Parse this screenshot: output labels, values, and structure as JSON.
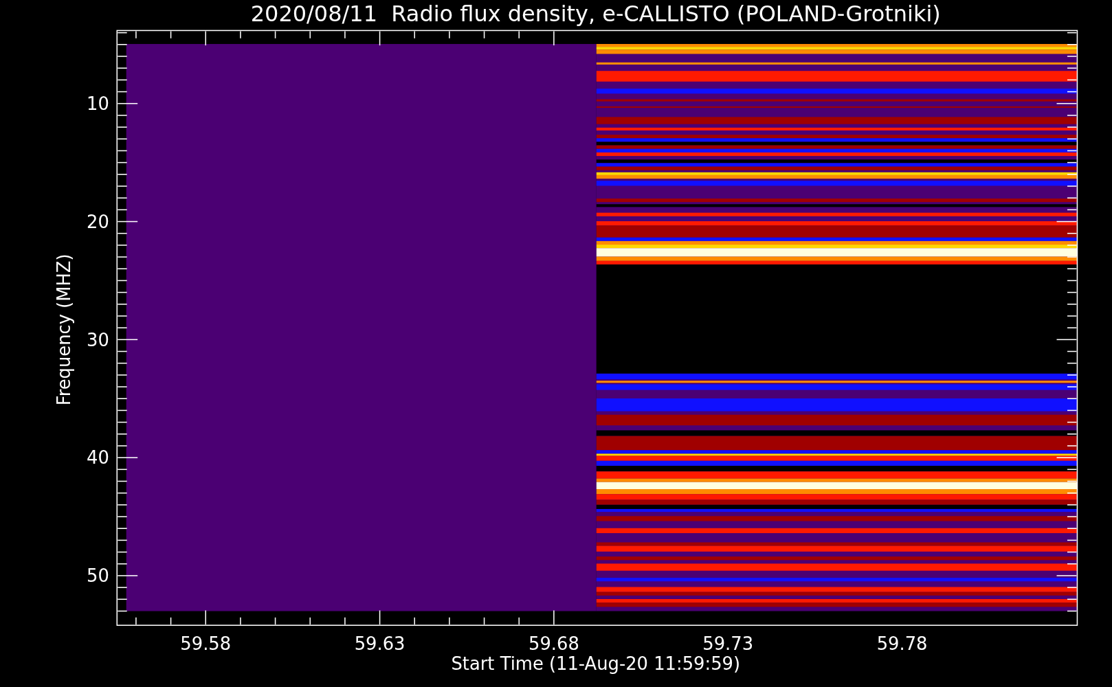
{
  "plot": {
    "title": "2020/08/11  Radio flux density, e-CALLISTO (POLAND-Grotniki)",
    "y_axis": {
      "label": "Frequency (MHZ)",
      "ticks": [
        "10",
        "20",
        "30",
        "40",
        "50"
      ]
    },
    "x_axis": {
      "label": "Start Time (11-Aug-20 11:59:59)",
      "ticks": [
        "59.58",
        "59.63",
        "59.68",
        "59.73",
        "59.78"
      ]
    }
  }
}
